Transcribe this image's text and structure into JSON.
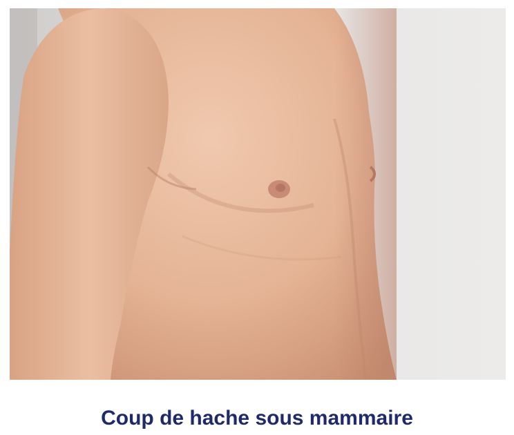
{
  "caption": {
    "text": "Coup de hache sous mammaire",
    "color": "#1f2a6b"
  },
  "photo": {
    "subject": "bare-torso-photograph",
    "background_color": "#e3e2e1",
    "skin_color": "#e8b89c"
  }
}
